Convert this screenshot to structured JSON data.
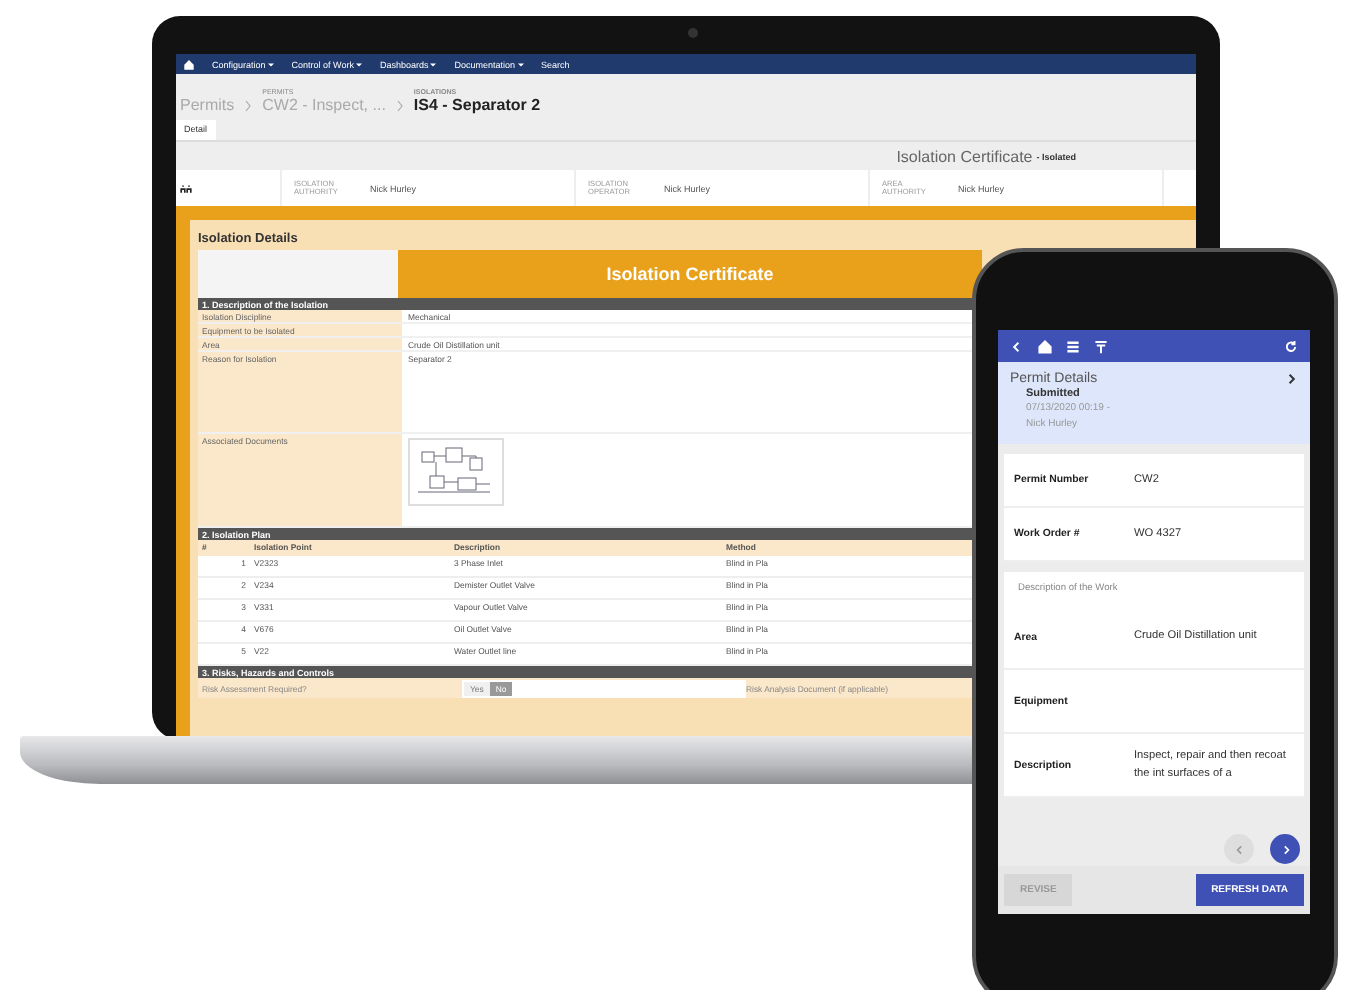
{
  "laptop": {
    "nav": [
      {
        "label": "Configuration",
        "dropdown": true
      },
      {
        "label": "Control of Work",
        "dropdown": true
      },
      {
        "label": "Dashboards",
        "dropdown": true
      },
      {
        "label": "Documentation",
        "dropdown": true
      },
      {
        "label": "Search",
        "dropdown": false
      }
    ],
    "breadcrumb": [
      {
        "label": "Permits",
        "current": false
      },
      {
        "caption": "PERMITS",
        "label": "CW2 - Inspect, ...",
        "current": false
      },
      {
        "caption": "ISOLATIONS",
        "label": "IS4 - Separator 2",
        "current": true
      }
    ],
    "tabs": [
      {
        "label": "Detail",
        "selected": true
      }
    ],
    "title": "Isolation Certificate",
    "status": "- Isolated",
    "roles": [
      {
        "label": "ISOLATION AUTHORITY",
        "name": "Nick Hurley"
      },
      {
        "label": "ISOLATION OPERATOR",
        "name": "Nick Hurley"
      },
      {
        "label": "AREA AUTHORITY",
        "name": "Nick Hurley"
      }
    ],
    "panel_title": "Isolation Details",
    "certificate_title": "Isolation Certificate",
    "description": {
      "title": "1. Description of the Isolation",
      "fields": [
        {
          "kind": "text",
          "label": "Isolation Discipline",
          "value": "Mechanical"
        },
        {
          "kind": "text",
          "label": "Equipment to be Isolated"
        },
        {
          "kind": "text",
          "label": "Area",
          "value": "Crude Oil Distillation unit"
        },
        {
          "kind": "tall",
          "label": "Reason for Isolation",
          "value": "Separator 2"
        },
        {
          "kind": "attachment",
          "label": "Associated Documents"
        }
      ]
    },
    "plan": {
      "title": "2. Isolation Plan",
      "columns": [
        "#",
        "Isolation Point",
        "Description",
        "Method"
      ],
      "rows": [
        [
          "1",
          "V2323",
          "3 Phase Inlet",
          "Blind in Pla"
        ],
        [
          "2",
          "V234",
          "Demister Outlet Valve",
          "Blind in Pla"
        ],
        [
          "3",
          "V331",
          "Vapour Outlet Valve",
          "Blind in Pla"
        ],
        [
          "4",
          "V676",
          "Oil Outlet Valve",
          "Blind in Pla"
        ],
        [
          "5",
          "V22",
          "Water Outlet line",
          "Blind in Pla"
        ]
      ]
    },
    "risks": {
      "title": "3. Risks, Hazards and Controls",
      "question": "Risk Assessment Required?",
      "options": [
        {
          "label": "Yes",
          "selected": false
        },
        {
          "label": "No",
          "selected": true
        }
      ],
      "document_label": "Risk Analysis Document (if applicable)"
    }
  },
  "phone": {
    "header": {
      "title": "Permit Details",
      "status": "Submitted",
      "meta": "07/13/2020 00:19 - Nick Hurley"
    },
    "fields": [
      {
        "label": "Permit Number",
        "value": "CW2"
      },
      {
        "label": "Work Order #",
        "value": "WO 4327"
      }
    ],
    "section_title": "Description of the Work",
    "work_fields": [
      {
        "label": "Area",
        "value": "Crude Oil Distillation unit"
      },
      {
        "label": "Equipment"
      },
      {
        "label": "Description",
        "value": "Inspect, repair and then recoat the int surfaces of a"
      }
    ],
    "buttons": [
      {
        "label": "REVISE",
        "disabled": true
      },
      {
        "label": "REFRESH DATA",
        "disabled": false
      }
    ]
  }
}
